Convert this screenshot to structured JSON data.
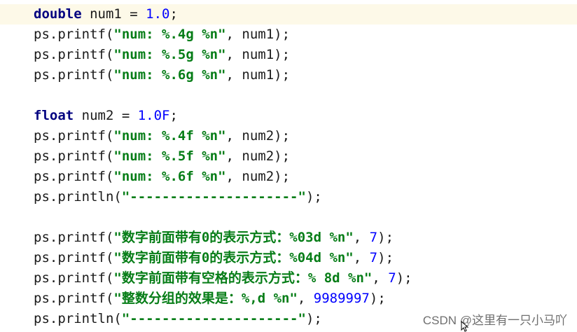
{
  "editor": {
    "lines": [
      [
        {
          "t": "double",
          "c": "kw"
        },
        {
          "t": " num1 = ",
          "c": "plain"
        },
        {
          "t": "1.0",
          "c": "num"
        },
        {
          "t": ";",
          "c": "plain"
        }
      ],
      [
        {
          "t": "ps.printf(",
          "c": "plain"
        },
        {
          "t": "\"num: %.4g %n\"",
          "c": "str"
        },
        {
          "t": ", num1);",
          "c": "plain"
        }
      ],
      [
        {
          "t": "ps.printf(",
          "c": "plain"
        },
        {
          "t": "\"num: %.5g %n\"",
          "c": "str"
        },
        {
          "t": ", num1);",
          "c": "plain"
        }
      ],
      [
        {
          "t": "ps.printf(",
          "c": "plain"
        },
        {
          "t": "\"num: %.6g %n\"",
          "c": "str"
        },
        {
          "t": ", num1);",
          "c": "plain"
        }
      ],
      [],
      [
        {
          "t": "float",
          "c": "kw"
        },
        {
          "t": " num2 = ",
          "c": "plain"
        },
        {
          "t": "1.0F",
          "c": "num"
        },
        {
          "t": ";",
          "c": "plain"
        }
      ],
      [
        {
          "t": "ps.printf(",
          "c": "plain"
        },
        {
          "t": "\"num: %.4f %n\"",
          "c": "str"
        },
        {
          "t": ", num2);",
          "c": "plain"
        }
      ],
      [
        {
          "t": "ps.printf(",
          "c": "plain"
        },
        {
          "t": "\"num: %.5f %n\"",
          "c": "str"
        },
        {
          "t": ", num2);",
          "c": "plain"
        }
      ],
      [
        {
          "t": "ps.printf(",
          "c": "plain"
        },
        {
          "t": "\"num: %.6f %n\"",
          "c": "str"
        },
        {
          "t": ", num2);",
          "c": "plain"
        }
      ],
      [
        {
          "t": "ps.println(",
          "c": "plain"
        },
        {
          "t": "\"---------------------\"",
          "c": "str"
        },
        {
          "t": ");",
          "c": "plain"
        }
      ],
      [],
      [
        {
          "t": "ps.printf(",
          "c": "plain"
        },
        {
          "t": "\"数字前面带有0的表示方式：%03d %n\"",
          "c": "str"
        },
        {
          "t": ", ",
          "c": "plain"
        },
        {
          "t": "7",
          "c": "num"
        },
        {
          "t": ");",
          "c": "plain"
        }
      ],
      [
        {
          "t": "ps.printf(",
          "c": "plain"
        },
        {
          "t": "\"数字前面带有0的表示方式：%04d %n\"",
          "c": "str"
        },
        {
          "t": ", ",
          "c": "plain"
        },
        {
          "t": "7",
          "c": "num"
        },
        {
          "t": ");",
          "c": "plain"
        }
      ],
      [
        {
          "t": "ps.printf(",
          "c": "plain"
        },
        {
          "t": "\"数字前面带有空格的表示方式：% 8d %n\"",
          "c": "str"
        },
        {
          "t": ", ",
          "c": "plain"
        },
        {
          "t": "7",
          "c": "num"
        },
        {
          "t": ");",
          "c": "plain"
        }
      ],
      [
        {
          "t": "ps.printf(",
          "c": "plain"
        },
        {
          "t": "\"整数分组的效果是：%,d %n\"",
          "c": "str"
        },
        {
          "t": ", ",
          "c": "plain"
        },
        {
          "t": "9989997",
          "c": "num"
        },
        {
          "t": ");",
          "c": "plain"
        }
      ],
      [
        {
          "t": "ps.println(",
          "c": "plain"
        },
        {
          "t": "\"---------------------\"",
          "c": "str"
        },
        {
          "t": ");",
          "c": "plain"
        }
      ]
    ],
    "current_line": 0
  },
  "watermark": "CSDN @这里有一只小马吖",
  "colors": {
    "keyword": "#000080",
    "number": "#0000ff",
    "string": "#067d17",
    "current_line_bg": "#fdf9e8"
  }
}
